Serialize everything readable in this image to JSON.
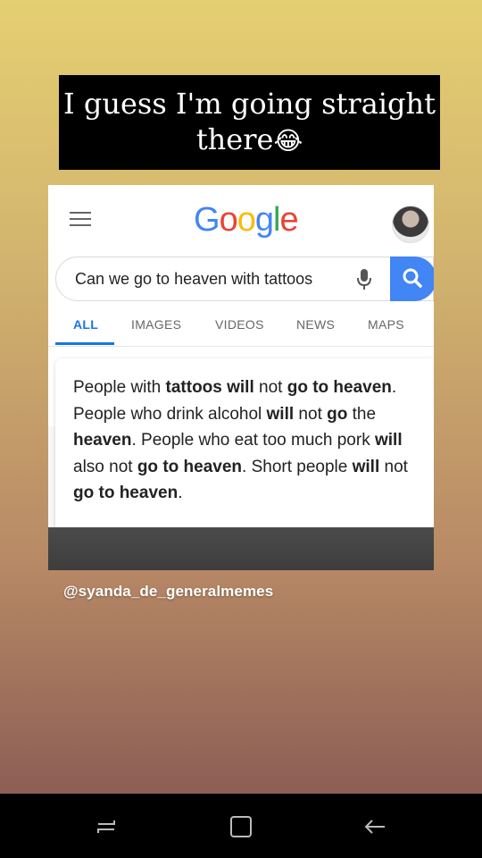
{
  "caption": {
    "line1": "I guess I'm going straight",
    "line2": "there",
    "emoji": "😂"
  },
  "screenshot": {
    "logo": "Google",
    "logo_colors": [
      "#4285f4",
      "#ea4335",
      "#fbbc05",
      "#4285f4",
      "#34a853",
      "#ea4335"
    ],
    "search_query": "Can we go to heaven with tattoos",
    "tabs": [
      "ALL",
      "IMAGES",
      "VIDEOS",
      "NEWS",
      "MAPS"
    ],
    "active_tab": "ALL",
    "snippet": [
      {
        "t": "People with ",
        "b": false
      },
      {
        "t": "tattoos will",
        "b": true
      },
      {
        "t": " not ",
        "b": false
      },
      {
        "t": "go to heaven",
        "b": true
      },
      {
        "t": ". People who drink alcohol ",
        "b": false
      },
      {
        "t": "will",
        "b": true
      },
      {
        "t": " not ",
        "b": false
      },
      {
        "t": "go",
        "b": true
      },
      {
        "t": " the ",
        "b": false
      },
      {
        "t": "heaven",
        "b": true
      },
      {
        "t": ". People who eat too much pork ",
        "b": false
      },
      {
        "t": "will",
        "b": true
      },
      {
        "t": " also not ",
        "b": false
      },
      {
        "t": "go to heaven",
        "b": true
      },
      {
        "t": ". Short people ",
        "b": false
      },
      {
        "t": "will",
        "b": true
      },
      {
        "t": " not ",
        "b": false
      },
      {
        "t": "go to heaven",
        "b": true
      },
      {
        "t": ".",
        "b": false
      }
    ]
  },
  "watermark": "@syanda_de_generalmemes",
  "colors": {
    "accent_blue": "#1a73e8",
    "search_button": "#4285f4",
    "caption_bg": "#000000"
  },
  "navbar": {
    "icons": [
      "recent-apps-icon",
      "home-icon",
      "back-icon"
    ]
  }
}
